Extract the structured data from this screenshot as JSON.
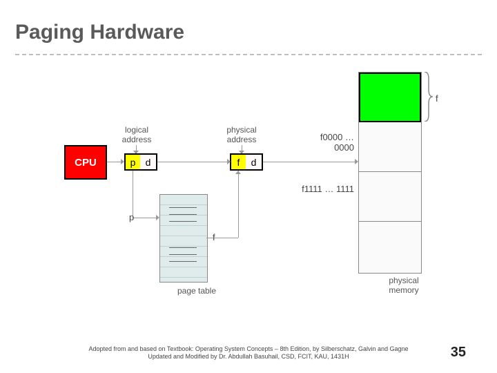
{
  "title": "Paging Hardware",
  "cpu_label": "CPU",
  "logical_address_label": "logical\naddress",
  "physical_address_label": "physical\naddress",
  "p_char": "p",
  "d_char_left": "d",
  "f_char": "f",
  "d_char_right": "d",
  "p_side_label": "p",
  "f_side_label": "f",
  "page_table_label": "page table",
  "physical_memory_label": "physical\nmemory",
  "frame_start_label": "f0000 … 0000",
  "frame_end_label": "f1111 … 1111",
  "frame_size_label": "f",
  "footer_line1": "Adopted from and based on Textbook: Operating System Concepts – 8th Edition, by Silberschatz, Galvin and Gagne",
  "footer_line2": "Updated and Modified by Dr. Abdullah Basuhail, CSD, FCIT, KAU, 1431H",
  "page_number": "35",
  "colors": {
    "cpu": "#ff0000",
    "highlight_field": "#ffff00",
    "mapped_frame": "#00ff00"
  }
}
